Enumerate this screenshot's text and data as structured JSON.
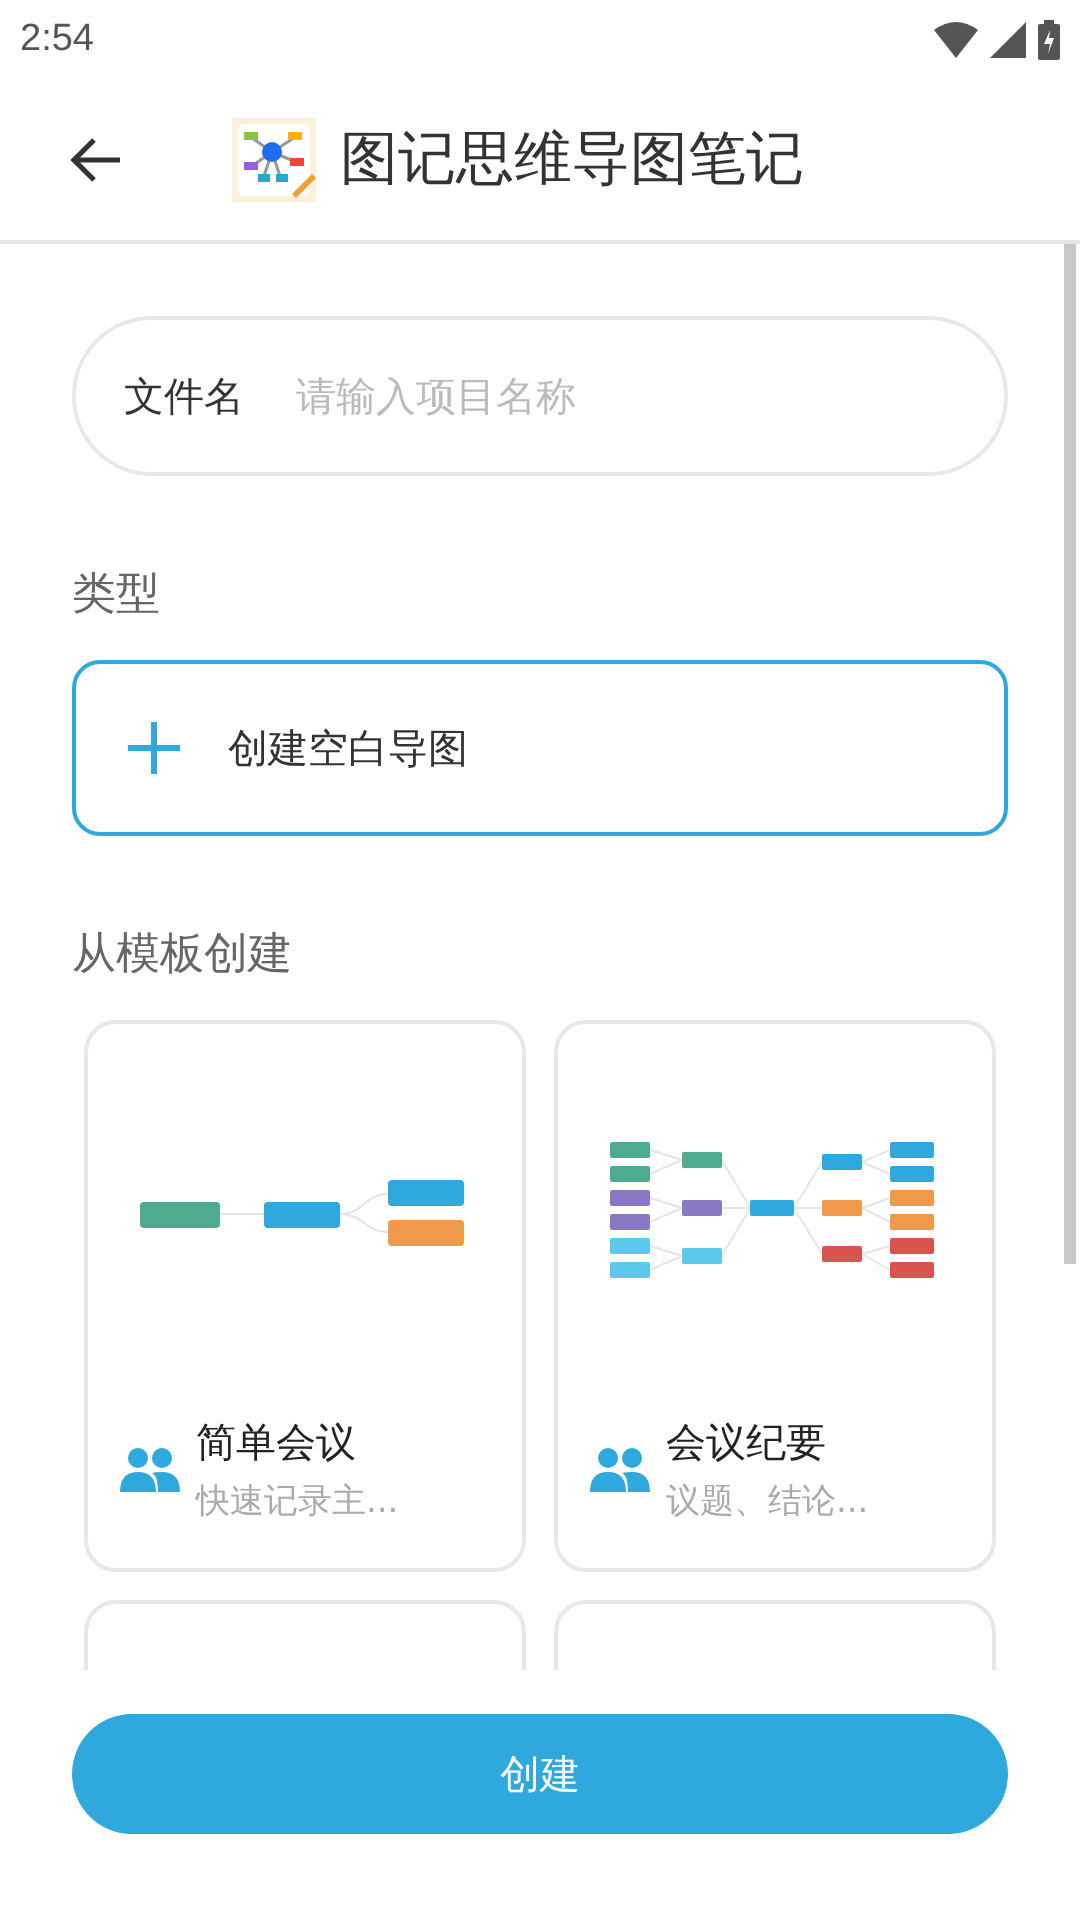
{
  "status_bar": {
    "time": "2:54"
  },
  "header": {
    "title": "图记思维导图笔记"
  },
  "file_name_field": {
    "label": "文件名",
    "placeholder": "请输入项目名称"
  },
  "type_section": {
    "title": "类型",
    "create_blank": "创建空白导图"
  },
  "template_section": {
    "title": "从模板创建",
    "templates": [
      {
        "kind": "simple",
        "title": "简单会议",
        "subtitle": "快速记录主..."
      },
      {
        "kind": "minutes",
        "title": "会议纪要",
        "subtitle": "议题、结论..."
      },
      {
        "kind": "hidden"
      },
      {
        "kind": "hidden"
      }
    ]
  },
  "create_button": "创建"
}
